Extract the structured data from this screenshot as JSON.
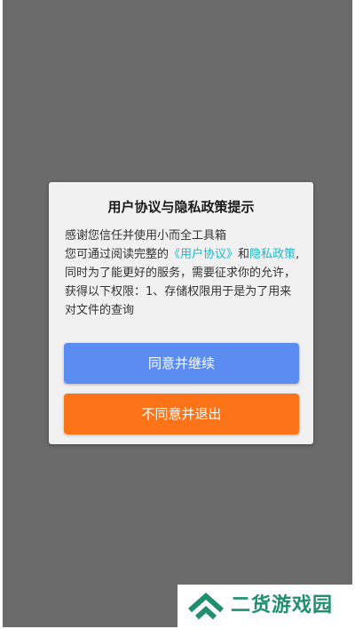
{
  "dialog": {
    "title": "用户协议与隐私政策提示",
    "intro": "感谢您信任并使用小而全工具箱",
    "read_prefix": "您可通过阅读完整的",
    "user_agreement_link": "《用户协议》",
    "and_text": "和",
    "privacy_policy_link": "隐私政策",
    "permission_text": ",同时为了能更好的服务，需要征求你的允许，获得以下权限：1、存储权限用于是为了用来对文件的查询",
    "agree_button": "同意并继续",
    "disagree_button": "不同意并退出"
  },
  "watermark": {
    "text": "二货游戏园"
  },
  "colors": {
    "overlay": "#6b6b6b",
    "link": "#1fb8c9",
    "agree": "#5b8cf2",
    "disagree": "#fd7418",
    "watermark": "#1f8f6f"
  }
}
